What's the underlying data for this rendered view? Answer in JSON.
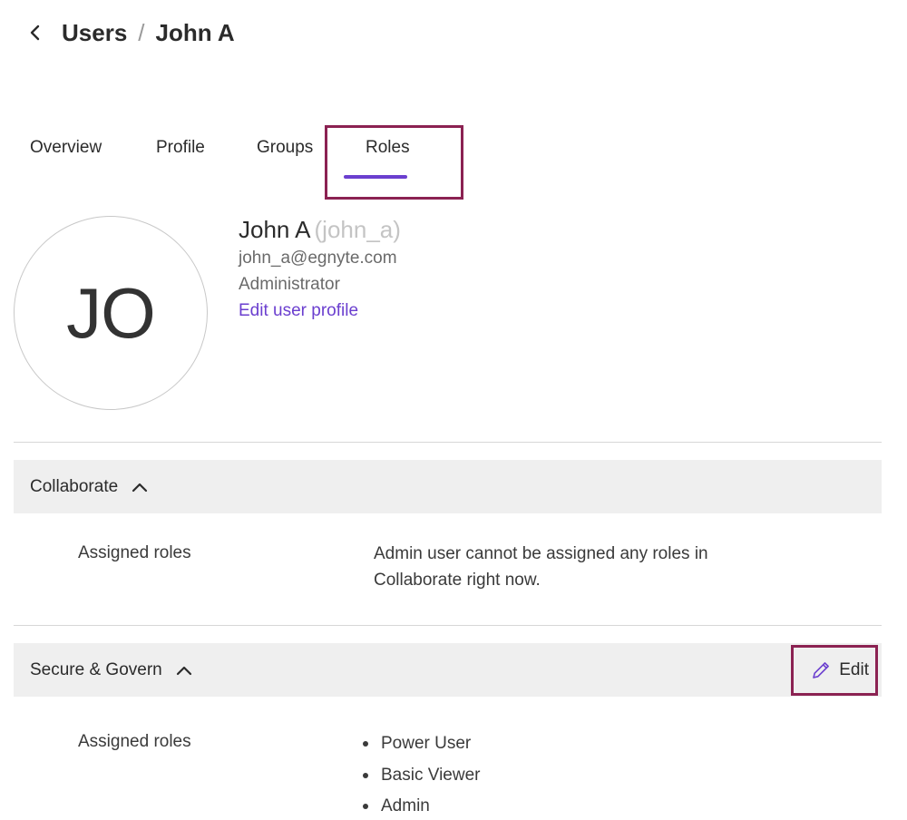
{
  "breadcrumb": {
    "parent": "Users",
    "separator": "/",
    "current": "John A"
  },
  "tabs": [
    {
      "label": "Overview"
    },
    {
      "label": "Profile"
    },
    {
      "label": "Groups"
    },
    {
      "label": "Roles",
      "active": true
    }
  ],
  "user": {
    "initials": "JO",
    "name": "John A",
    "username": "(john_a)",
    "email": "john_a@egnyte.com",
    "role": "Administrator",
    "edit_link": "Edit user profile"
  },
  "sections": {
    "collaborate": {
      "title": "Collaborate",
      "label": "Assigned roles",
      "message": "Admin user cannot be assigned any roles in Collaborate right now."
    },
    "secure": {
      "title": "Secure & Govern",
      "edit_label": "Edit",
      "label": "Assigned roles",
      "roles": [
        "Power User",
        "Basic Viewer",
        "Admin"
      ]
    }
  },
  "colors": {
    "accent": "#6b3fcf",
    "highlight": "#8b2252",
    "section_bg": "#efefef"
  },
  "icons": {
    "back": "chevron-left-icon",
    "collapse": "chevron-up-icon",
    "edit": "pencil-icon"
  }
}
